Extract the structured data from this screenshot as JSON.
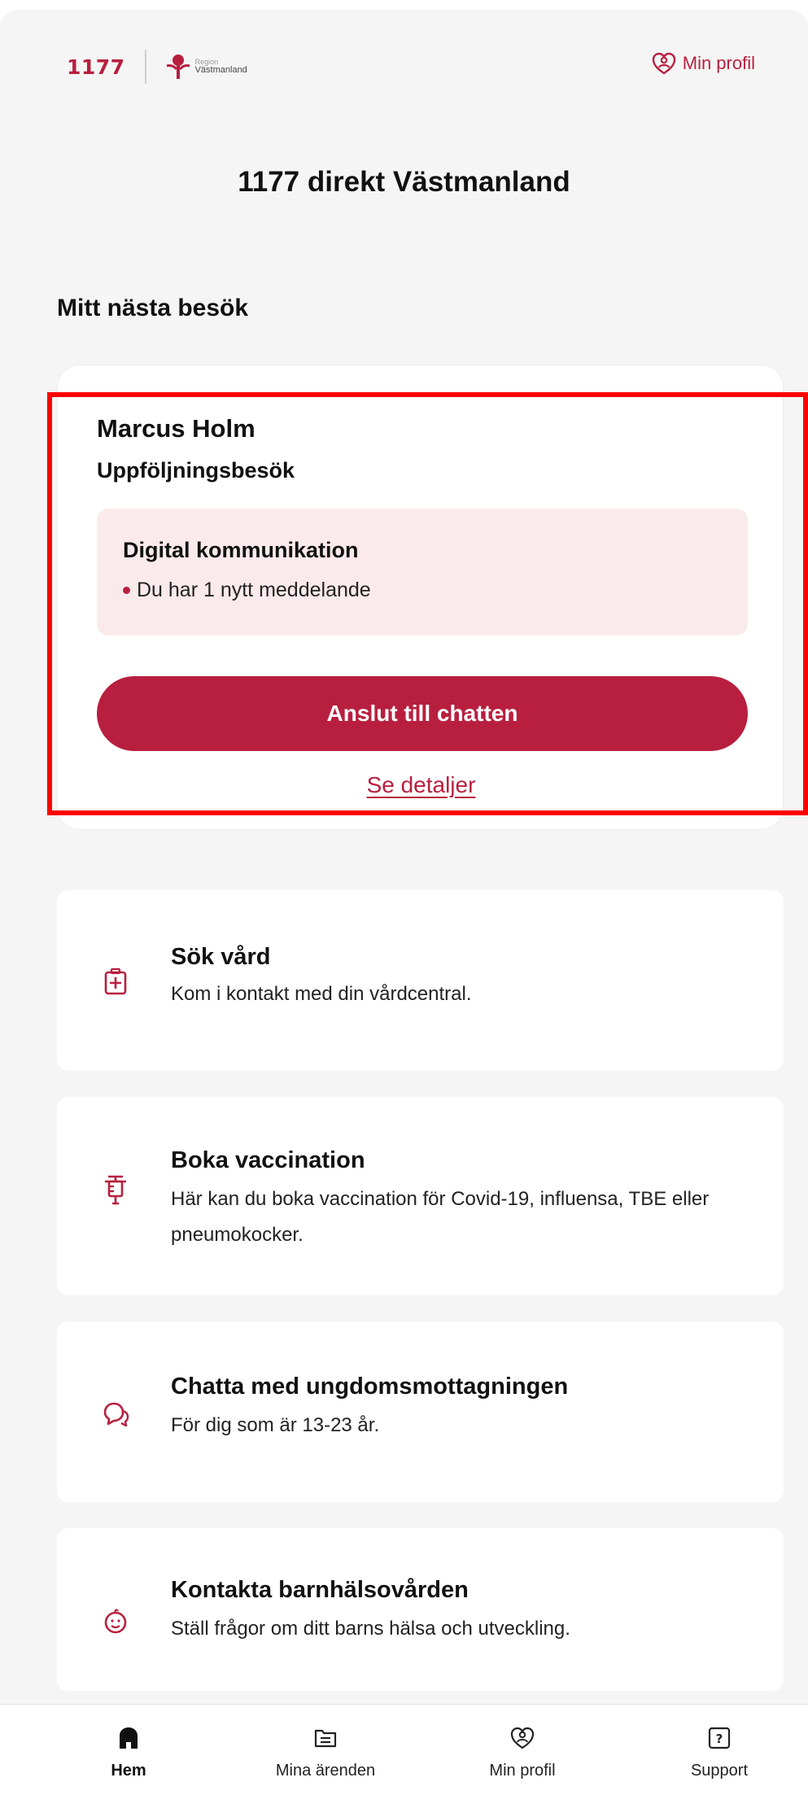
{
  "header": {
    "logo_number": "1177",
    "logo_region_small": "Region",
    "logo_region_name": "Västmanland",
    "profile_label": "Min profil",
    "profile_icon": "person-heart-icon"
  },
  "page": {
    "title": "1177 direkt Västmanland"
  },
  "next_visit": {
    "section_title": "Mitt nästa besök",
    "name": "Marcus Holm",
    "type": "Uppföljningsbesök",
    "message_box": {
      "title": "Digital kommunikation",
      "line": "Du har 1 nytt meddelande"
    },
    "join_button": "Anslut till chatten",
    "details_link": "Se detaljer"
  },
  "services": [
    {
      "icon": "medical-plus-icon",
      "title": "Sök vård",
      "description": "Kom i kontakt med din vårdcentral."
    },
    {
      "icon": "syringe-icon",
      "title": "Boka vaccination",
      "description": "Här kan du boka vaccination för Covid-19, influensa, TBE eller pneumokocker."
    },
    {
      "icon": "chat-bubbles-icon",
      "title": "Chatta med ungdomsmottagningen",
      "description": "För dig som är 13-23 år."
    },
    {
      "icon": "baby-face-icon",
      "title": "Kontakta barnhälsovården",
      "description": "Ställ frågor om ditt barns hälsa och utveckling."
    }
  ],
  "bottom_nav": [
    {
      "label": "Hem",
      "icon": "home-icon",
      "active": true
    },
    {
      "label": "Mina ärenden",
      "icon": "inbox-icon",
      "active": false
    },
    {
      "label": "Min profil",
      "icon": "person-heart-icon",
      "active": false
    },
    {
      "label": "Support",
      "icon": "help-icon",
      "active": false
    }
  ],
  "colors": {
    "accent": "#b81f3f",
    "background": "#f5f5f5",
    "message_box": "#fbeaec",
    "highlight": "#ff0000"
  }
}
